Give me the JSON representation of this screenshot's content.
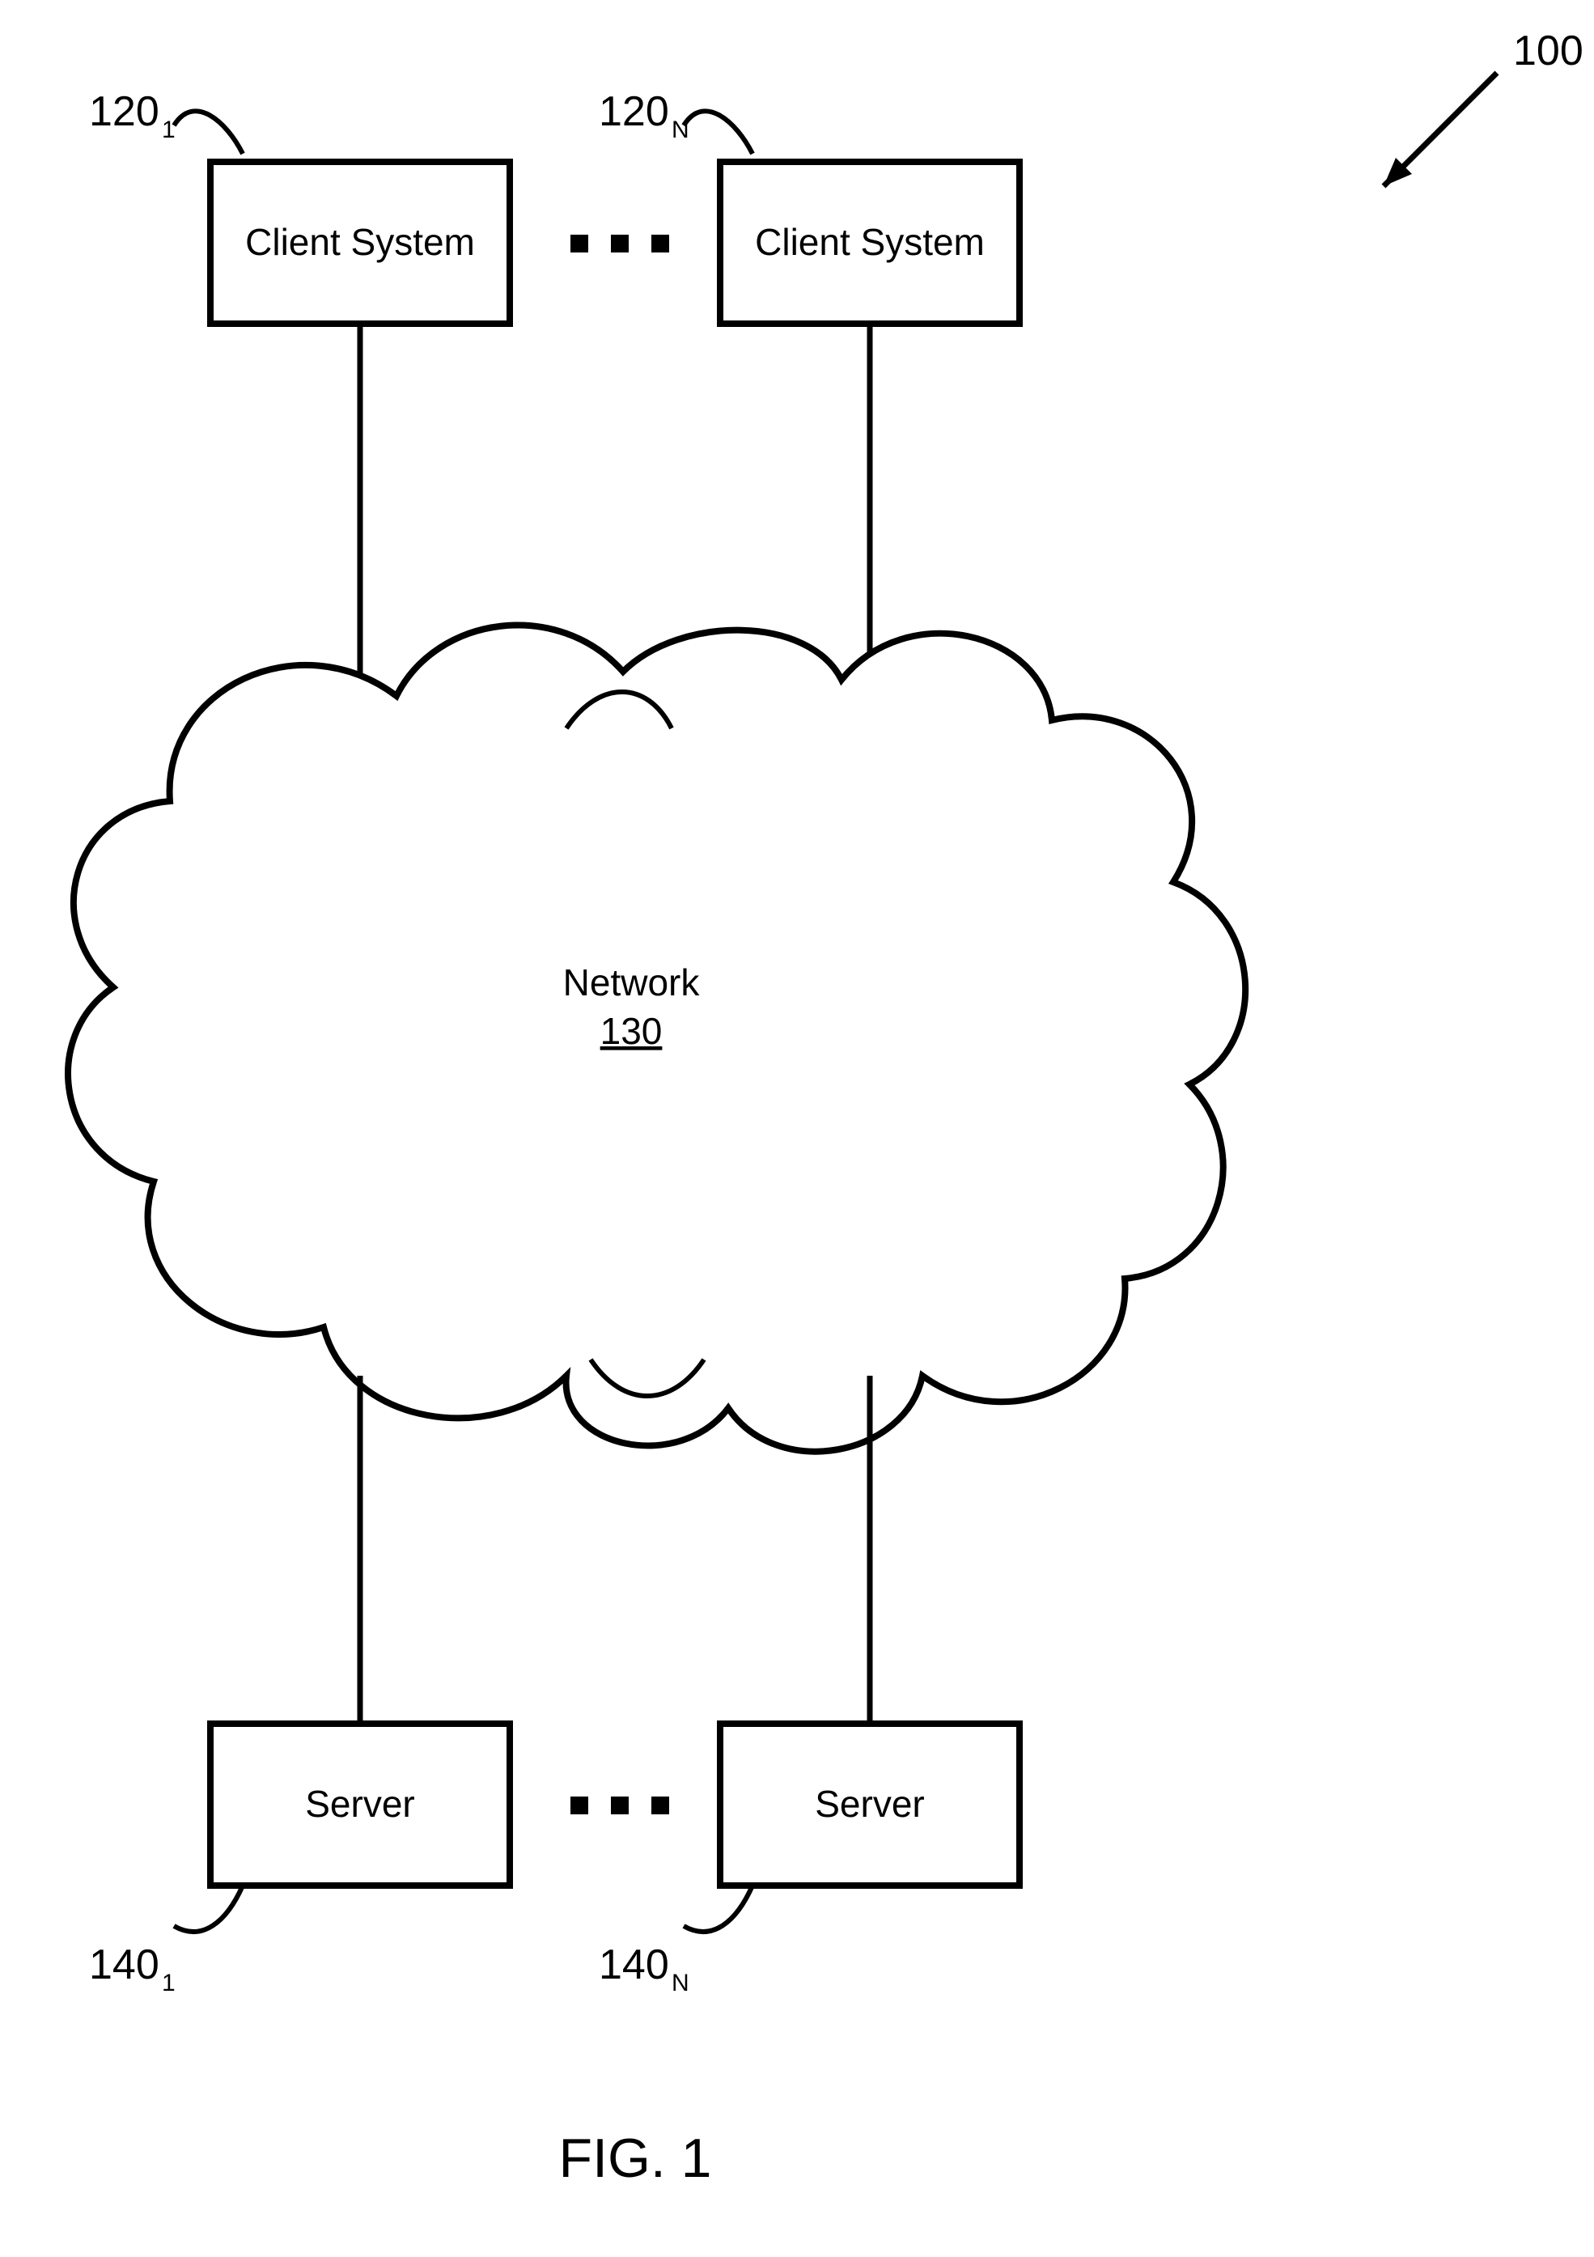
{
  "figure": {
    "ref": "100",
    "caption": "FIG. 1"
  },
  "clients": {
    "label": "Client System",
    "first_ref_base": "120",
    "first_ref_sub": "1",
    "last_ref_base": "120",
    "last_ref_sub": "N"
  },
  "network": {
    "label": "Network",
    "ref": "130"
  },
  "servers": {
    "label": "Server",
    "first_ref_base": "140",
    "first_ref_sub": "1",
    "last_ref_base": "140",
    "last_ref_sub": "N"
  }
}
